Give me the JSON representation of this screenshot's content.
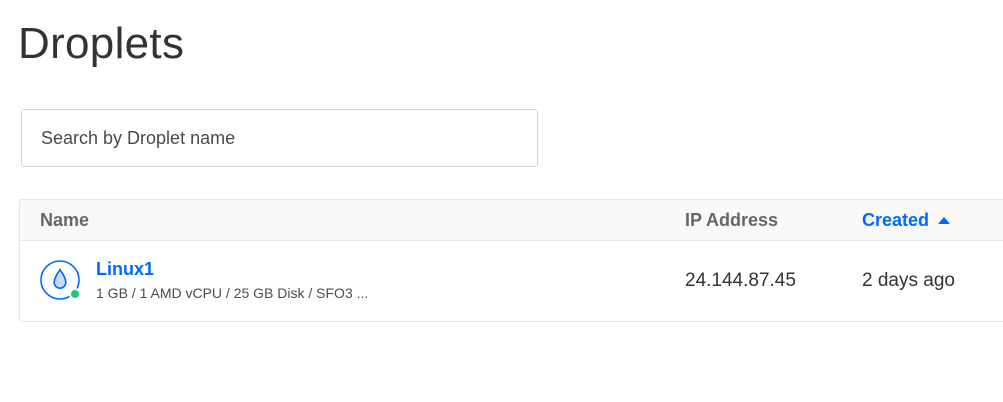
{
  "page": {
    "title": "Droplets"
  },
  "search": {
    "placeholder": "Search by Droplet name",
    "value": ""
  },
  "table": {
    "columns": {
      "name": "Name",
      "ip": "IP Address",
      "created": "Created"
    },
    "sort": {
      "column": "created",
      "direction": "ascending"
    },
    "rows": [
      {
        "name": "Linux1",
        "specs": "1 GB / 1 AMD vCPU / 25 GB Disk / SFO3 ...",
        "ip": "24.144.87.45",
        "created": "2 days ago",
        "status": "active"
      }
    ]
  },
  "icons": {
    "droplet": "droplet-icon",
    "status": "status-online-dot",
    "sort": "caret-up-icon"
  },
  "colors": {
    "accent": "#0069ff",
    "status_active": "#15cd72",
    "title": "#333333",
    "header_text": "#676767"
  }
}
